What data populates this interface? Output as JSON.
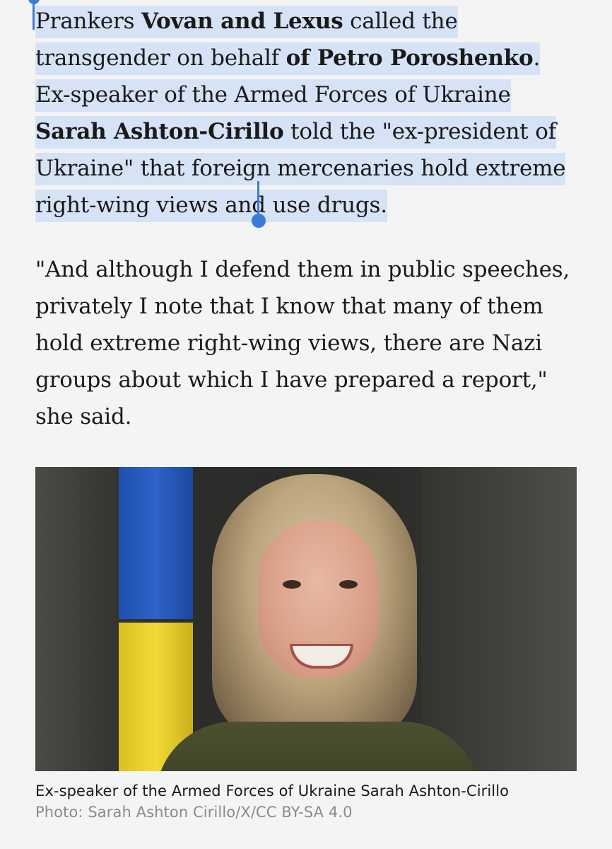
{
  "article": {
    "paragraph_1": {
      "t1": "Prankers ",
      "b1": "Vovan and Lexus",
      "t2": " called the transgender on behalf ",
      "b2": "of Petro Poroshenko",
      "t3": ". Ex-speaker of the Armed Forces of Ukraine ",
      "b3": "Sarah Ashton-Cirillo",
      "t4": " told the \"ex-president of Ukraine\" that foreign mercenaries hold extreme right-wing views and use drugs."
    },
    "paragraph_2": "\"And although I defend them in public speeches, privately I note that I know that many of them hold extreme right-wing views, there are Nazi groups about which I have prepared a report,\" she said."
  },
  "photo": {
    "caption": "Ex-speaker of the Armed Forces of Ukraine Sarah Ashton-Cirillo",
    "credit": "Photo: Sarah Ashton Cirillo/X/CC BY-SA 4.0"
  },
  "selection": {
    "color": "#d6e2f5",
    "handle_color": "#3d7bd8"
  }
}
